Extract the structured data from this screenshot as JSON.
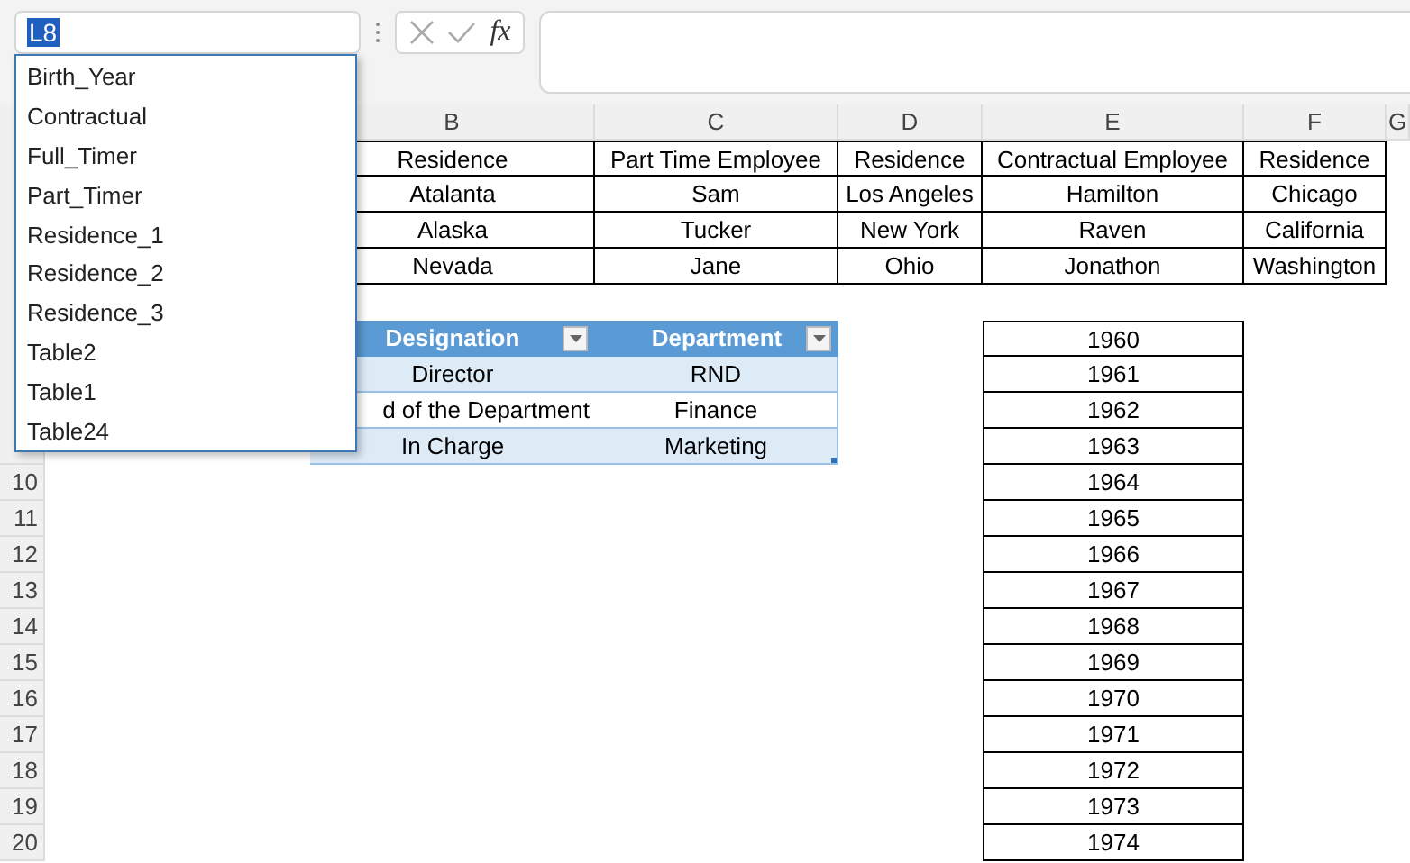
{
  "name_box": {
    "value": "L8",
    "text_selected": true
  },
  "formula_bar": {
    "function_label": "fx"
  },
  "names_list": [
    {
      "label": "Birth_Year"
    },
    {
      "label": "Contractual"
    },
    {
      "label": "Full_Timer"
    },
    {
      "label": "Part_Timer"
    },
    {
      "label": "Residence_1"
    },
    {
      "label": "Residence_2"
    },
    {
      "label": "Residence_3"
    },
    {
      "label": "Table2"
    },
    {
      "label": "Table1"
    },
    {
      "label": "Table24"
    }
  ],
  "column_headers": [
    "B",
    "C",
    "D",
    "E",
    "F",
    "G"
  ],
  "row_headers": [
    "10",
    "11",
    "12",
    "13",
    "14",
    "15",
    "16",
    "17",
    "18",
    "19",
    "20"
  ],
  "employee_table": {
    "columns": [
      "Residence",
      "Part Time Employee",
      "Residence",
      "Contractual Employee",
      "Residence"
    ],
    "rows": [
      [
        "Atalanta",
        "Sam",
        "Los Angeles",
        "Hamilton",
        "Chicago"
      ],
      [
        "Alaska",
        "Tucker",
        "New York",
        "Raven",
        "California"
      ],
      [
        "Nevada",
        "Jane",
        "Ohio",
        "Jonathon",
        "Washington"
      ]
    ]
  },
  "designation_table": {
    "columns": [
      "Designation",
      "Department"
    ],
    "rows": [
      [
        "Director",
        "RND"
      ],
      [
        "d of the Department",
        "Finance"
      ],
      [
        "In Charge",
        "Marketing"
      ]
    ]
  },
  "birth_years": [
    "1960",
    "1961",
    "1962",
    "1963",
    "1964",
    "1965",
    "1966",
    "1967",
    "1968",
    "1969",
    "1970",
    "1971",
    "1972",
    "1973",
    "1974"
  ]
}
